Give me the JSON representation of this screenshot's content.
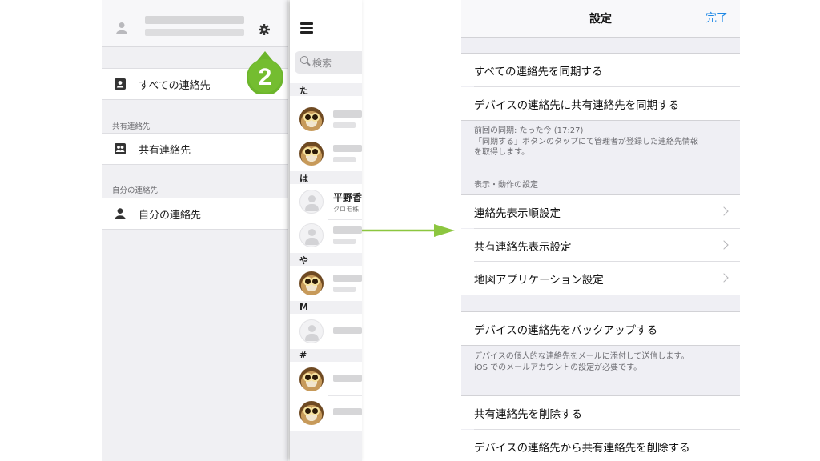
{
  "drawer": {
    "all_contacts": "すべての連絡先",
    "shared_section": "共有連絡先",
    "shared_contacts": "共有連絡先",
    "my_section": "自分の連絡先",
    "my_contacts": "自分の連絡先"
  },
  "step_badge": "2",
  "contacts": {
    "search_placeholder": "検索",
    "index": [
      "た",
      "は",
      "や",
      "M",
      "#"
    ],
    "visible_name": "平野香",
    "visible_company": "クロモ株"
  },
  "settings": {
    "title": "設定",
    "done": "完了",
    "sync_all": "すべての連絡先を同期する",
    "sync_shared_to_device": "デバイスの連絡先に共有連絡先を同期する",
    "last_sync_lines": [
      "前回の同期: たった今 (17:27)",
      "「同期する」ボタンのタップにて管理者が登録した連絡先情報",
      "を取得します。"
    ],
    "display_section": "表示・動作の設定",
    "order_setting": "連絡先表示順設定",
    "shared_display_setting": "共有連絡先表示設定",
    "map_app_setting": "地図アプリケーション設定",
    "backup": "デバイスの連絡先をバックアップする",
    "backup_note_lines": [
      "デバイスの個人的な連絡先をメールに添付して送信します。",
      "iOS でのメールアカウントの設定が必要です。"
    ],
    "delete_shared": "共有連絡先を削除する",
    "delete_shared_from_device": "デバイスの連絡先から共有連絡先を削除する"
  },
  "colors": {
    "accent": "#1e88e5",
    "badge_green": "#6cb52c",
    "arrow_green": "#8cc63f"
  }
}
